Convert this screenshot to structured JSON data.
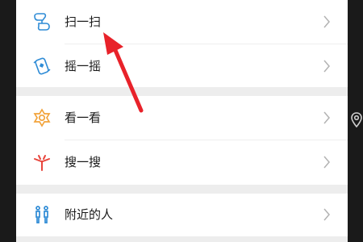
{
  "menu": {
    "items": [
      {
        "label": "扫一扫",
        "icon": "scan-icon"
      },
      {
        "label": "摇一摇",
        "icon": "shake-icon"
      },
      {
        "label": "看一看",
        "icon": "look-icon"
      },
      {
        "label": "搜一搜",
        "icon": "search-icon"
      },
      {
        "label": "附近的人",
        "icon": "people-nearby-icon"
      }
    ]
  },
  "annotation": {
    "arrow_color": "#e8222a",
    "points_to": "扫一扫"
  },
  "colors": {
    "accent_blue": "#2f8cd6",
    "look_orange": "#f2a33a",
    "search_red": "#e8453c"
  }
}
